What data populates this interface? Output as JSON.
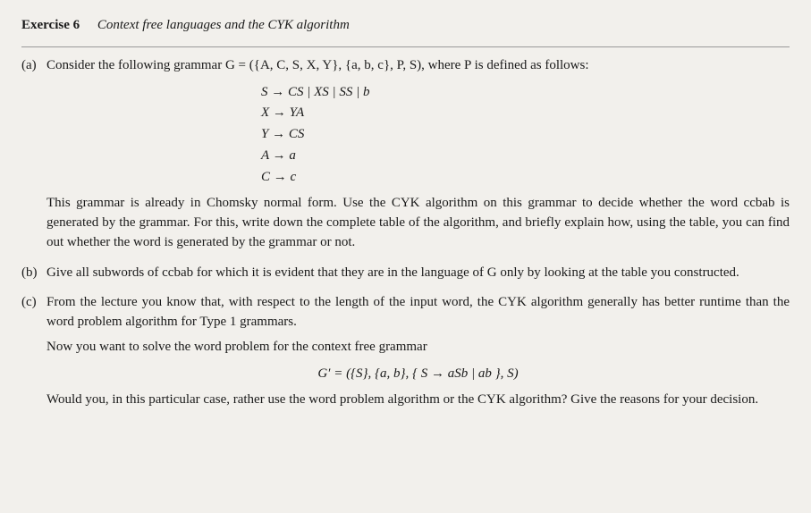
{
  "header": {
    "label": "Exercise 6",
    "title": "Context free languages and the CYK algorithm"
  },
  "parts": {
    "a": {
      "label": "(a)",
      "intro": "Consider the following grammar G = ({A, C, S, X, Y}, {a, b, c}, P, S), where P is defined as follows:",
      "grammar": [
        "S → CS | XS | SS | b",
        "X → YA",
        "Y → CS",
        "A → a",
        "C → c"
      ],
      "body": "This grammar is already in Chomsky normal form. Use the CYK algorithm on this grammar to decide whether the word ccbab is generated by the grammar. For this, write down the complete table of the algorithm, and briefly explain how, using the table, you can find out whether the word is generated by the grammar or not."
    },
    "b": {
      "label": "(b)",
      "body": "Give all subwords of ccbab for which it is evident that they are in the language of G only by looking at the table you constructed."
    },
    "c": {
      "label": "(c)",
      "body1": "From the lecture you know that, with respect to the length of the input word, the CYK algorithm generally has better runtime than the word problem algorithm for Type 1 grammars.",
      "body2": "Now you want to solve the word problem for the context free grammar",
      "equation": "G′ = ({S}, {a, b}, { S → aSb | ab }, S)",
      "body3": "Would you, in this particular case, rather use the word problem algorithm or the CYK algorithm? Give the reasons for your decision."
    }
  }
}
